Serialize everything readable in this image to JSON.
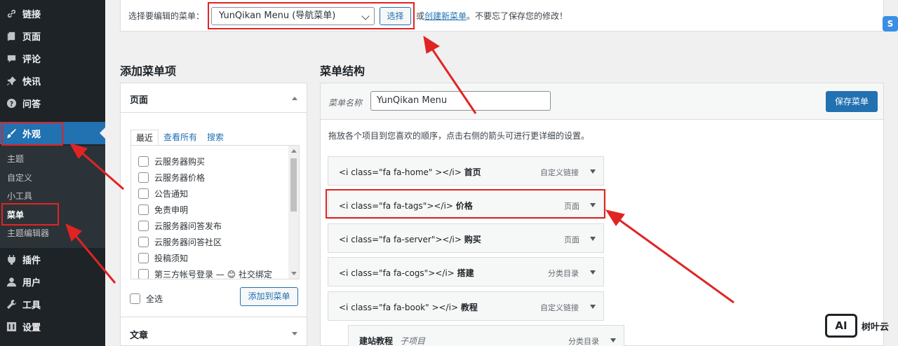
{
  "sidebar": {
    "items": [
      {
        "label": "链接",
        "icon": "link-icon"
      },
      {
        "label": "页面",
        "icon": "pages-icon"
      },
      {
        "label": "评论",
        "icon": "comments-icon"
      },
      {
        "label": "快讯",
        "icon": "pin-icon"
      },
      {
        "label": "问答",
        "icon": "help-icon"
      },
      {
        "label": "外观",
        "icon": "appearance-brush-icon"
      },
      {
        "label": "插件",
        "icon": "plugins-icon"
      },
      {
        "label": "用户",
        "icon": "users-icon"
      },
      {
        "label": "工具",
        "icon": "tools-icon"
      },
      {
        "label": "设置",
        "icon": "settings-icon"
      }
    ],
    "submenu": [
      "主题",
      "自定义",
      "小工具",
      "菜单",
      "主题编辑器"
    ]
  },
  "select_bar": {
    "label": "选择要编辑的菜单：",
    "selected": "YunQikan Menu (导航菜单)",
    "button": "选择",
    "hint_prefix": "或",
    "hint_link": "创建新菜单",
    "hint_suffix": "。不要忘了保存您的修改！"
  },
  "add_items": {
    "heading": "添加菜单项",
    "pages_title": "页面",
    "tabs": [
      "最近",
      "查看所有",
      "搜索"
    ],
    "pages": [
      "云服务器购买",
      "云服务器价格",
      "公告通知",
      "免责申明",
      "云服务器问答发布",
      "云服务器问答社区",
      "投稿须知",
      "第三方帐号登录 — 😊 社交绑定"
    ],
    "select_all": "全选",
    "add_button": "添加到菜单",
    "posts_title": "文章"
  },
  "structure": {
    "heading": "菜单结构",
    "name_label": "菜单名称",
    "name_value": "YunQikan Menu",
    "save_button": "保存菜单",
    "instructions": "拖放各个项目到您喜欢的顺序，点击右侧的箭头可进行更详细的设置。",
    "items": [
      {
        "code": "<i class=\"fa fa-home\" ></i>",
        "title": "首页",
        "type": "自定义链接"
      },
      {
        "code": "<i class=\"fa fa-tags\"></i>",
        "title": "价格",
        "type": "页面"
      },
      {
        "code": "<i class=\"fa fa-server\"></i>",
        "title": "购买",
        "type": "页面"
      },
      {
        "code": "<i class=\"fa fa-cogs\"></i>",
        "title": "搭建",
        "type": "分类目录"
      },
      {
        "code": "<i class=\"fa fa-book\" ></i>",
        "title": "教程",
        "type": "自定义链接"
      }
    ],
    "sub_item": {
      "title": "建站教程",
      "subtag": "子项目",
      "type": "分类目录"
    }
  },
  "watermark": {
    "logo": "AI",
    "text": "树叶云"
  },
  "badge": "S",
  "colors": {
    "accent": "#2271b1",
    "sidebar_bg": "#1d2327",
    "annotation_red": "#e02424"
  }
}
